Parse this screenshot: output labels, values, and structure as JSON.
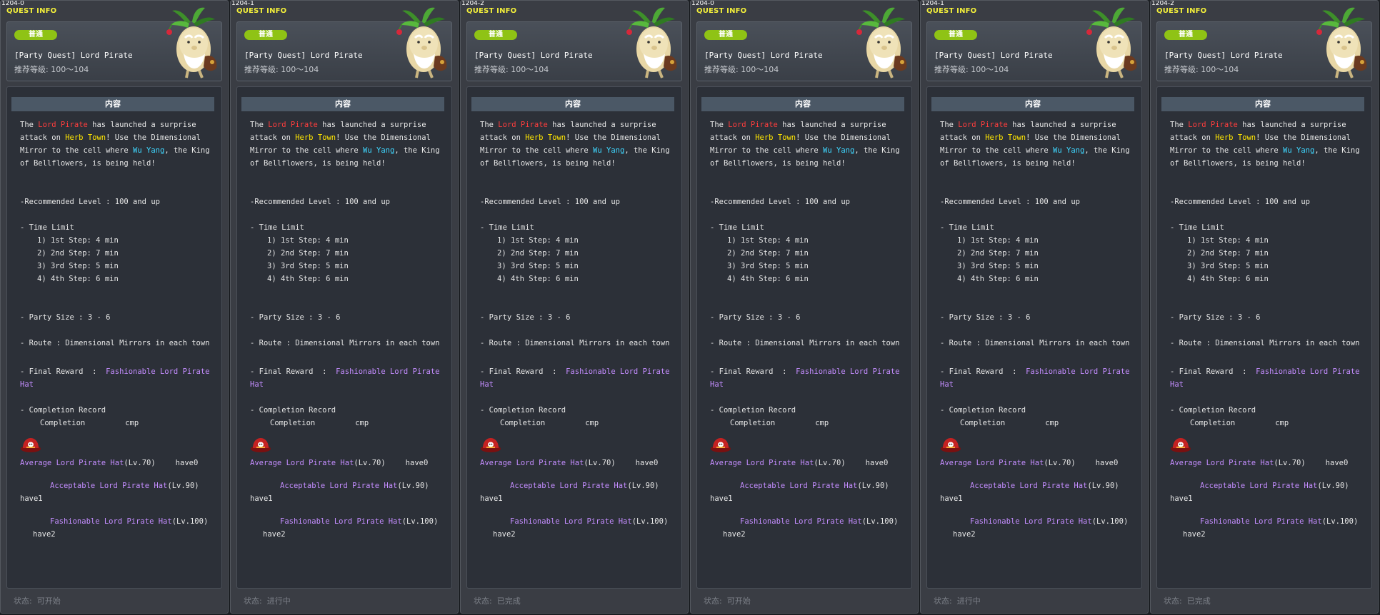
{
  "header_label": "QUEST INFO",
  "section_title": "内容",
  "difficulty_badge": "普通",
  "quest_title": "[Party Quest] Lord Pirate",
  "recommended_level": "推荐等级: 100～104",
  "status_prefix": "状态:",
  "colors": {
    "badge": "#8fc315",
    "highlight_red": "#ff3d3d",
    "highlight_yellow": "#ffe600",
    "highlight_cyan": "#3fd7ff",
    "item_purple": "#c48dff",
    "header_yellow": "#f3ef3a"
  },
  "description": {
    "l1_a": "The ",
    "l1_b": "Lord Pirate",
    "l1_c": " has launched a surprise",
    "l2_a": "attack on ",
    "l2_b": "Herb Town",
    "l2_c": "! Use the Dimensional",
    "l3_a": "Mirror to the cell where ",
    "l3_b": "Wu Yang",
    "l3_c": ", the King",
    "l4": "of Bellflowers, is being held!"
  },
  "rec_level_line": "-Recommended Level : 100 and up",
  "time_limit_title": "- Time Limit",
  "time_steps": [
    "1) 1st Step: 4 min",
    "2) 2nd Step: 7 min",
    "3) 3rd Step: 5 min",
    "4) 4th Step: 6 min"
  ],
  "party_size_line": "- Party Size  : 3 - 6",
  "route_line": "- Route  : Dimensional Mirrors in each town",
  "final_reward_prefix": "- Final Reward  :  ",
  "final_reward_item_1": "Fashionable Lord Pirate",
  "final_reward_item_2": "Hat",
  "completion_title": "- Completion Record",
  "completion_label": "Completion",
  "completion_value": "cmp",
  "hats": [
    {
      "name": "Average Lord Pirate Hat",
      "level": "(Lv.70)",
      "have": "have0"
    },
    {
      "name": "Acceptable Lord Pirate Hat",
      "level": "(Lv.90)",
      "have": "have1"
    },
    {
      "name": "Fashionable Lord Pirate Hat",
      "level": "(Lv.100)",
      "have": "have2"
    }
  ],
  "panels": [
    {
      "code": "1204-0",
      "status": "可开始"
    },
    {
      "code": "1204-1",
      "status": "进行中"
    },
    {
      "code": "1204-2",
      "status": "已完成"
    },
    {
      "code": "1204-0",
      "status": "可开始"
    },
    {
      "code": "1204-1",
      "status": "进行中"
    },
    {
      "code": "1204-2",
      "status": "已完成"
    }
  ]
}
